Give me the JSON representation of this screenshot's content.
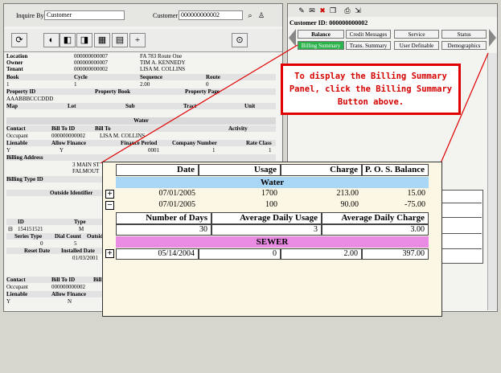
{
  "header": {
    "inquire_label": "Inquire By",
    "inquire_value": "Customer",
    "customer_label": "Customer",
    "customer_value": "000000000002"
  },
  "right_panel": {
    "customer_id_label": "Customer ID:",
    "customer_id": "000000000002",
    "tabs": [
      "Balance",
      "Credit Messages",
      "Service",
      "Status",
      "Billing Summary",
      "Trans. Summary",
      "User Definable",
      "Demographics"
    ]
  },
  "details": {
    "location_label": "Location",
    "location_value": "000000000007",
    "location_addr": "FA 783 Route One",
    "owner_label": "Owner",
    "owner_value": "000000000007",
    "owner_name": "TIM A. KENNEDY",
    "tenant_label": "Tenant",
    "tenant_value": "000000000002",
    "tenant_name": "LISA M. COLLINS",
    "book_headers": [
      "Book",
      "Cycle",
      "Sequence",
      "Route"
    ],
    "book_values": [
      "1",
      "1",
      "2.00",
      "0"
    ],
    "prop_headers": [
      "Property ID",
      "Property Book",
      "Property Page"
    ],
    "prop_value": "AAABBBCCCDDD",
    "map_headers": [
      "Map",
      "Lot",
      "Sub",
      "Tract",
      "Unit"
    ],
    "water_title": "Water",
    "contact_headers": [
      "Contact",
      "Bill To ID",
      "Bill To",
      "Activity"
    ],
    "contact_values": [
      "Occupant",
      "000000000002",
      "LISA M. COLLINS"
    ],
    "lienable_headers": [
      "Lienable",
      "Allow Finance",
      "Finance Period",
      "Company Number",
      "Rate Class"
    ],
    "lienable_values": [
      "Y",
      "Y",
      "0001",
      "1",
      "1"
    ],
    "billing_addr_label": "Billing Address",
    "billing_addr_1": "3 MAIN ST",
    "billing_addr_2": "FALMOUT",
    "billing_type_label": "Billing Type ID",
    "outside_label": "Outside Identifier",
    "id_headers": [
      "ID",
      "Type"
    ],
    "id_value": "154151521",
    "id_type": "M",
    "series_headers": [
      "Series Type",
      "Dial Count",
      "Outside"
    ],
    "series_values": [
      "0",
      "5"
    ],
    "reset_headers": [
      "Reset Date",
      "Installed Date"
    ],
    "installed_value": "01/03/2001",
    "contact2_headers": [
      "Contact",
      "Bill To ID",
      "Bill To"
    ],
    "contact2_values": [
      "Occupant",
      "000000000002"
    ],
    "lienable2_headers": [
      "Lienable",
      "Allow Finance"
    ],
    "lienable2_values": [
      "Y",
      "N"
    ]
  },
  "callout": {
    "line1": "To display the Billing Summary",
    "line2": "Panel, click the Billing Summary",
    "line3": "Button above."
  },
  "billing_summary": {
    "headers": [
      "Date",
      "Usage",
      "Charge",
      "P. O. S. Balance"
    ],
    "water_title": "Water",
    "water_rows": [
      {
        "sign": "+",
        "date": "07/01/2005",
        "usage": "1700",
        "charge": "213.00",
        "balance": "15.00"
      },
      {
        "sign": "−",
        "date": "07/01/2005",
        "usage": "100",
        "charge": "90.00",
        "balance": "-75.00"
      }
    ],
    "sub_headers": [
      "Number of Days",
      "Average Daily Usage",
      "Average Daily Charge"
    ],
    "sub_values": [
      "30",
      "3",
      "3.00"
    ],
    "sewer_title": "SEWER",
    "sewer_rows": [
      {
        "sign": "+",
        "date": "05/14/2004",
        "usage": "0",
        "charge": "2.00",
        "balance": "397.00"
      }
    ]
  },
  "colors": {
    "water_banner": "#a9d6f5",
    "sewer_banner": "#e98be3",
    "callout_red": "#e00000",
    "active_tab": "#2bb34b"
  }
}
